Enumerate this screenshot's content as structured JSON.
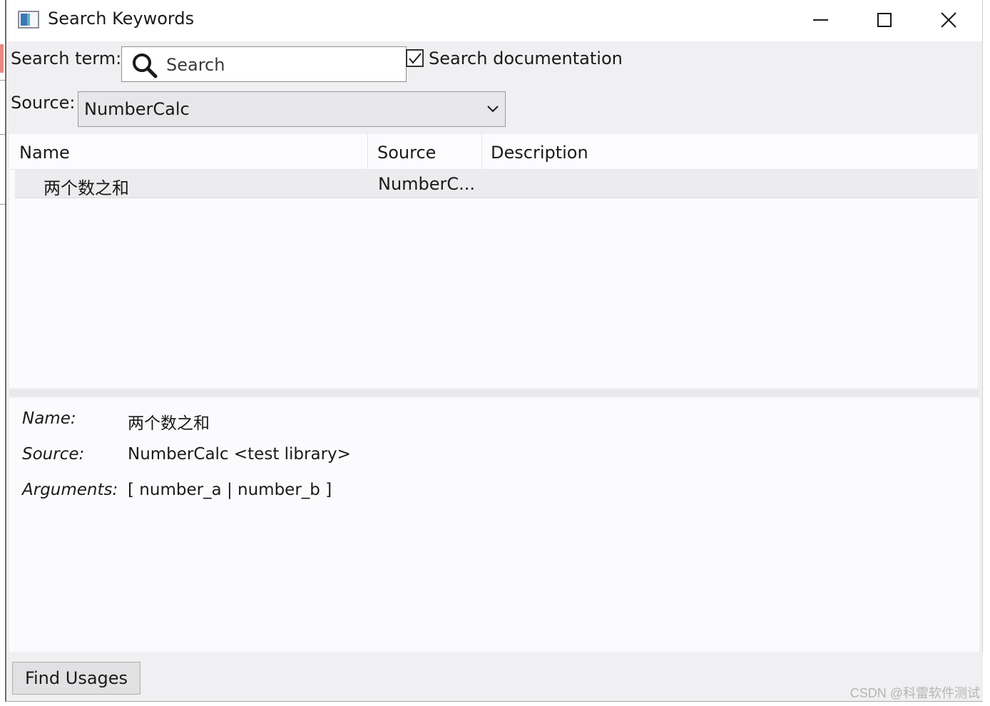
{
  "window": {
    "title": "Search Keywords"
  },
  "search": {
    "label": "Search term:",
    "placeholder": "Search",
    "value": "",
    "documentation_label": "Search documentation",
    "documentation_checked": true
  },
  "source_filter": {
    "label": "Source:",
    "selected": "NumberCalc"
  },
  "table": {
    "columns": [
      "Name",
      "Source",
      "Description"
    ],
    "rows": [
      {
        "name": "两个数之和",
        "source": "NumberC...",
        "description": ""
      }
    ]
  },
  "details": {
    "name_label": "Name:",
    "name_value": "两个数之和",
    "source_label": "Source:",
    "source_value": "NumberCalc <test library>",
    "arguments_label": "Arguments:",
    "arguments_value": "[ number_a | number_b ]"
  },
  "footer": {
    "find_usages_label": "Find Usages",
    "watermark": "CSDN @科雷软件测试"
  },
  "icons": {
    "app": "app-window-icon",
    "search": "search-icon",
    "dropdown": "chevron-down-icon",
    "minimize": "minimize-icon",
    "maximize": "maximize-icon",
    "close": "close-icon"
  }
}
